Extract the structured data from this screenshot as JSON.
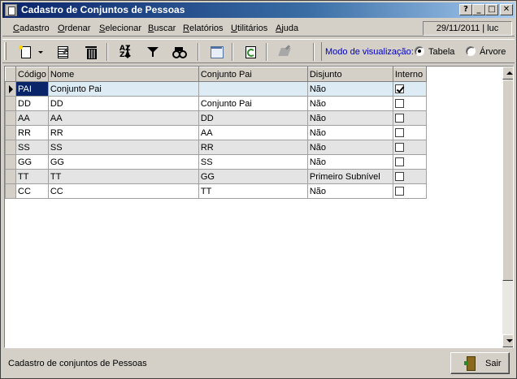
{
  "window": {
    "title": "Cadastro de Conjuntos de Pessoas",
    "controls": {
      "help": "?",
      "minimize": "_",
      "maximize": "□",
      "close": "✕"
    }
  },
  "menu": {
    "items": [
      {
        "label": "Cadastro",
        "accel": "C",
        "rest": "adastro"
      },
      {
        "label": "Ordenar",
        "accel": "O",
        "rest": "rdenar"
      },
      {
        "label": "Selecionar",
        "accel": "S",
        "rest": "elecionar"
      },
      {
        "label": "Buscar",
        "accel": "B",
        "rest": "uscar"
      },
      {
        "label": "Relatórios",
        "accel": "R",
        "rest": "elatórios"
      },
      {
        "label": "Utilitários",
        "accel": "U",
        "rest": "tilitários"
      },
      {
        "label": "Ajuda",
        "accel": "A",
        "pre": "",
        "rest": "juda"
      }
    ],
    "status_date": "29/11/2011 | luc"
  },
  "toolbar": {
    "buttons": [
      "new-icon",
      "edit-icon",
      "trash-icon",
      "sort-az-icon",
      "filter-icon",
      "binoculars-icon",
      "view-icon",
      "refresh-icon",
      "disabled-edit-icon"
    ],
    "sort_top": "AZ",
    "sort_bottom": "ZA",
    "view_mode_label": "Modo de visualização:",
    "view_options": [
      {
        "label": "Tabela",
        "checked": true
      },
      {
        "label": "Árvore",
        "checked": false
      }
    ]
  },
  "grid": {
    "columns": [
      "Código",
      "Nome",
      "Conjunto Pai",
      "Disjunto",
      "Interno"
    ],
    "rows": [
      {
        "codigo": "PAI",
        "nome": "Conjunto Pai",
        "pai": "",
        "disjunto": "Não",
        "interno": true
      },
      {
        "codigo": "DD",
        "nome": "DD",
        "pai": "Conjunto Pai",
        "disjunto": "Não",
        "interno": false
      },
      {
        "codigo": "AA",
        "nome": "AA",
        "pai": "DD",
        "disjunto": "Não",
        "interno": false
      },
      {
        "codigo": "RR",
        "nome": "RR",
        "pai": "AA",
        "disjunto": "Não",
        "interno": false
      },
      {
        "codigo": "SS",
        "nome": "SS",
        "pai": "RR",
        "disjunto": "Não",
        "interno": false
      },
      {
        "codigo": "GG",
        "nome": "GG",
        "pai": "SS",
        "disjunto": "Não",
        "interno": false
      },
      {
        "codigo": "TT",
        "nome": "TT",
        "pai": "GG",
        "disjunto": "Primeiro Subnível",
        "interno": false
      },
      {
        "codigo": "CC",
        "nome": "CC",
        "pai": "TT",
        "disjunto": "Não",
        "interno": false
      }
    ]
  },
  "footer": {
    "status": "Cadastro de conjuntos de Pessoas",
    "exit_label": "Sair"
  },
  "colors": {
    "titlebar_start": "#0a246a",
    "selected_cell": "#0a246a",
    "selected_row": "#dcebf4",
    "alt_row": "#e4e4e4",
    "view_label": "#0000c0"
  }
}
